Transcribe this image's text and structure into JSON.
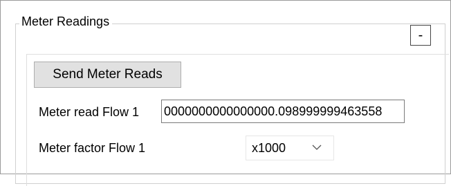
{
  "group": {
    "title": "Meter Readings",
    "collapse_label": "-"
  },
  "send_button": {
    "label": "Send Meter Reads"
  },
  "meter_read": {
    "label": "Meter read Flow 1",
    "value": "0000000000000000.098999999463558"
  },
  "meter_factor": {
    "label": "Meter factor Flow 1",
    "selected": "x1000",
    "icon": "chevron-down-icon"
  }
}
